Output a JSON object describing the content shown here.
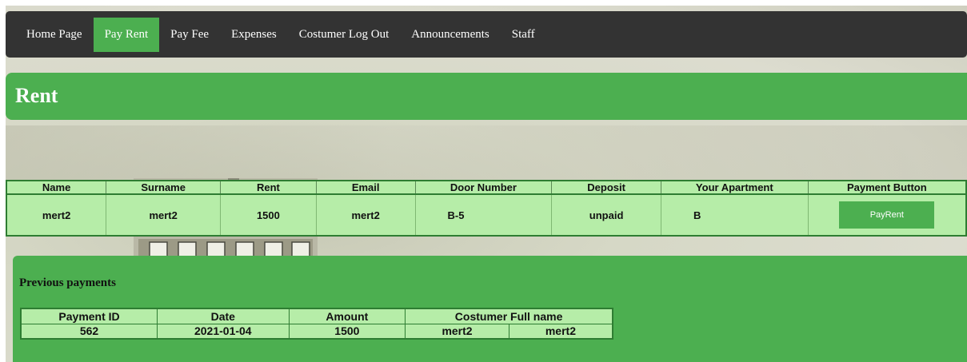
{
  "nav": {
    "items": [
      {
        "label": "Home Page",
        "active": false
      },
      {
        "label": "Pay Rent",
        "active": true
      },
      {
        "label": "Pay Fee",
        "active": false
      },
      {
        "label": "Expenses",
        "active": false
      },
      {
        "label": "Costumer Log Out",
        "active": false
      },
      {
        "label": "Announcements",
        "active": false
      },
      {
        "label": "Staff",
        "active": false
      }
    ]
  },
  "header": {
    "title": "Rent"
  },
  "rent_table": {
    "headers": [
      "Name",
      "Surname",
      "Rent",
      "Email",
      "Door Number",
      "Deposit",
      "Your Apartment",
      "Payment Button"
    ],
    "row": {
      "name": "mert2",
      "surname": "mert2",
      "rent": "1500",
      "email": "mert2",
      "door_number": "B-5",
      "deposit": "unpaid",
      "apartment": "B",
      "button_label": "PayRent"
    }
  },
  "previous_payments": {
    "title": "Previous payments",
    "headers": [
      "Payment ID",
      "Date",
      "Amount",
      "Costumer Full name"
    ],
    "rows": [
      {
        "payment_id": "562",
        "date": "2021-01-04",
        "amount": "1500",
        "first_name": "mert2",
        "last_name": "mert2"
      }
    ]
  },
  "colors": {
    "nav_bg": "#333333",
    "accent": "#4caf50",
    "table_bg": "#b6eda8",
    "border": "#2e7d32"
  }
}
